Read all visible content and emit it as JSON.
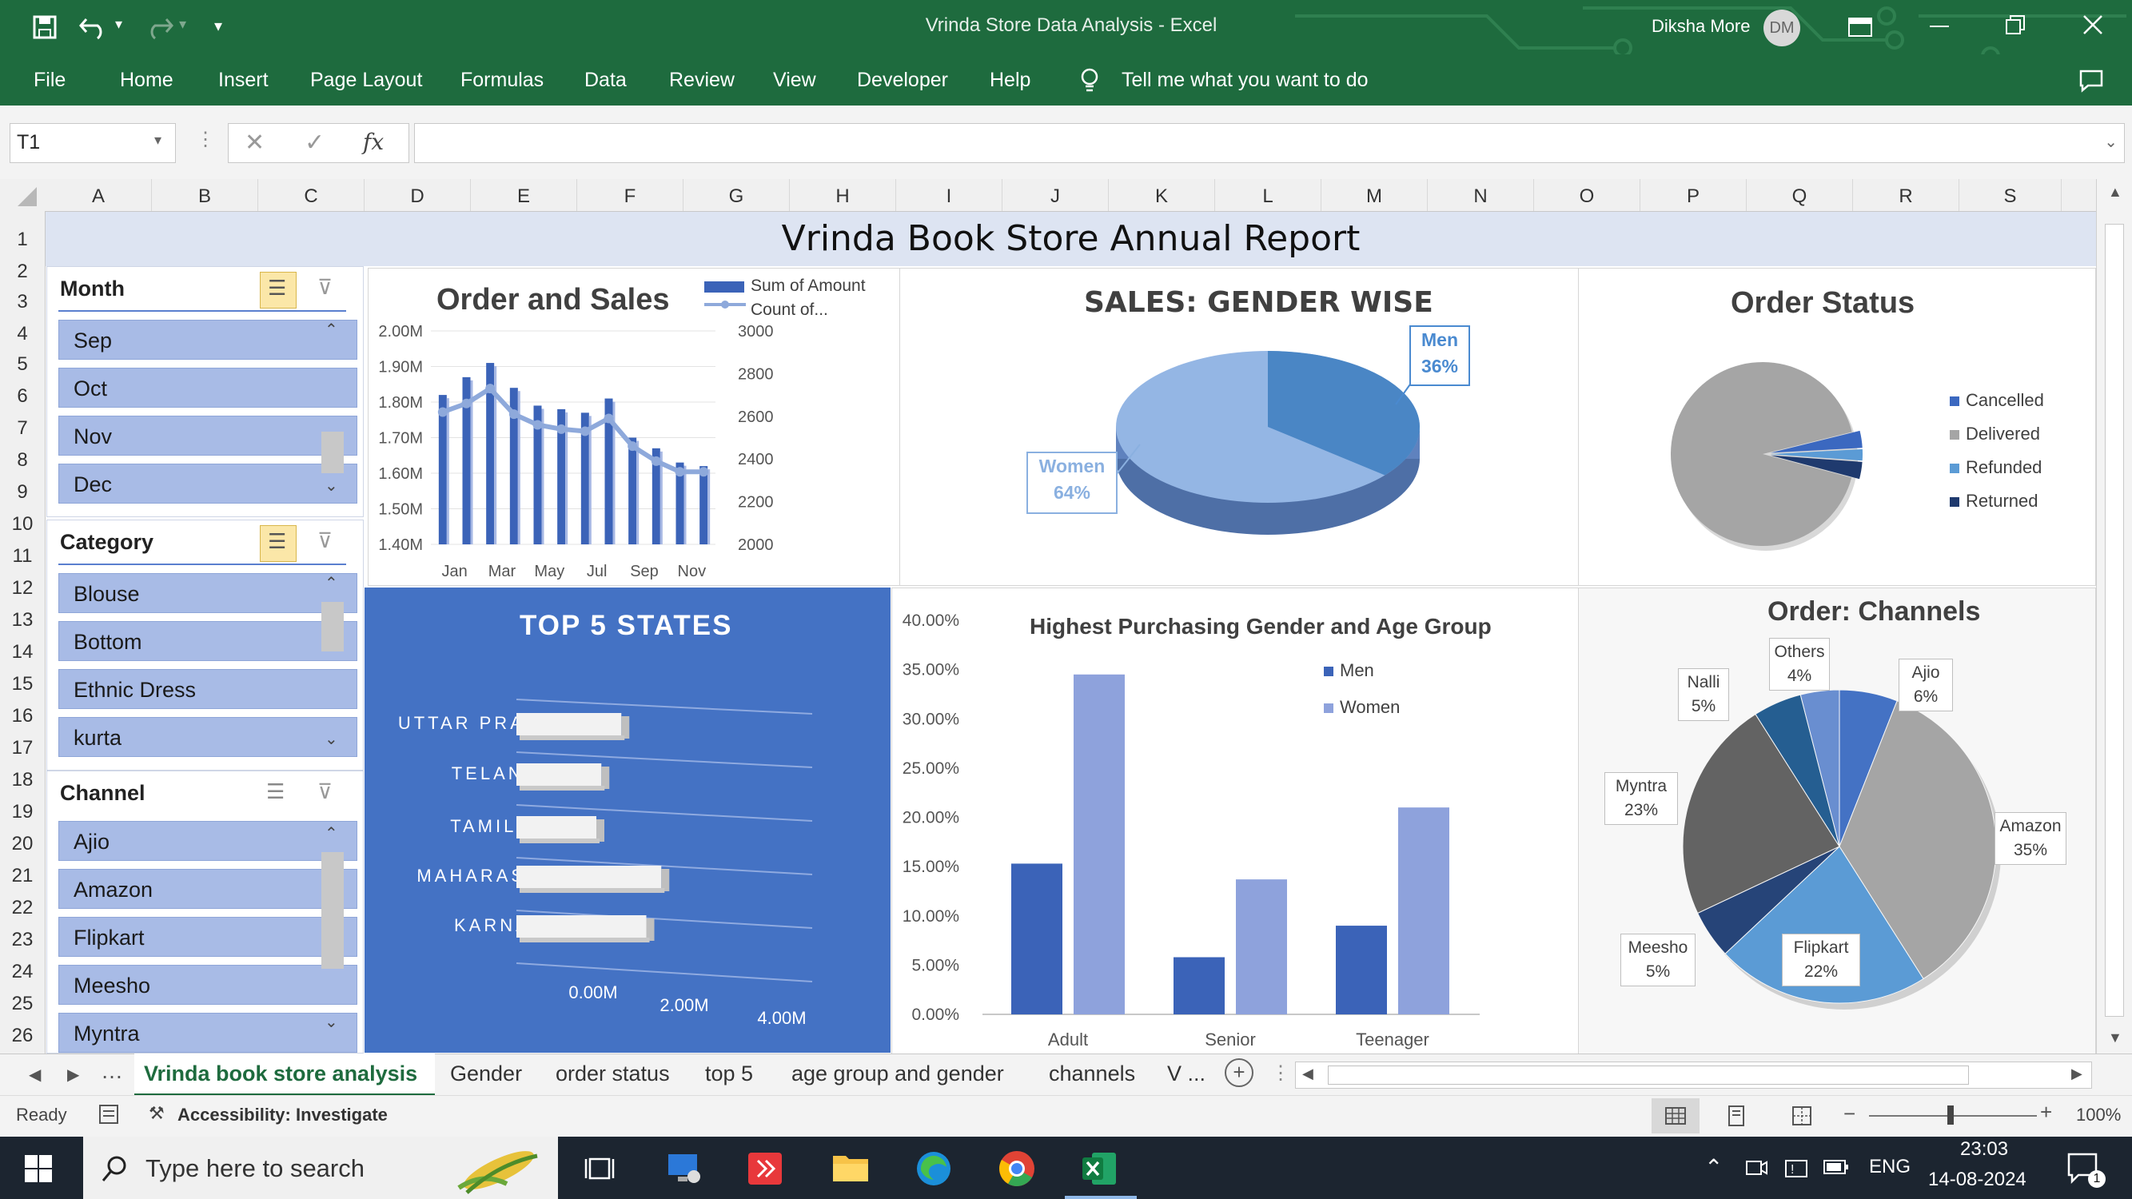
{
  "window": {
    "title": "Vrinda Store Data Analysis  -  Excel",
    "user": "Diksha More",
    "user_initials": "DM"
  },
  "ribbon": {
    "tabs": [
      "File",
      "Home",
      "Insert",
      "Page Layout",
      "Formulas",
      "Data",
      "Review",
      "View",
      "Developer",
      "Help"
    ],
    "tell_me": "Tell me what you want to do"
  },
  "formula_bar": {
    "name_box": "T1",
    "fx": "fx",
    "formula": ""
  },
  "columns": [
    "A",
    "B",
    "C",
    "D",
    "E",
    "F",
    "G",
    "H",
    "I",
    "J",
    "K",
    "L",
    "M",
    "N",
    "O",
    "P",
    "Q",
    "R",
    "S"
  ],
  "rows": [
    "1",
    "2",
    "3",
    "4",
    "5",
    "6",
    "7",
    "8",
    "9",
    "10",
    "11",
    "12",
    "13",
    "14",
    "15",
    "16",
    "17",
    "18",
    "19",
    "20",
    "21",
    "22",
    "23",
    "24",
    "25",
    "26"
  ],
  "report_title": "Vrinda Book Store Annual Report",
  "slicers": {
    "month": {
      "title": "Month",
      "items": [
        "Sep",
        "Oct",
        "Nov",
        "Dec"
      ]
    },
    "category": {
      "title": "Category",
      "items": [
        "Blouse",
        "Bottom",
        "Ethnic Dress",
        "kurta"
      ]
    },
    "channel": {
      "title": "Channel",
      "items": [
        "Ajio",
        "Amazon",
        "Flipkart",
        "Meesho",
        "Myntra"
      ]
    }
  },
  "chart_data": [
    {
      "type": "bar",
      "title": "Order and Sales",
      "categories": [
        "Jan",
        "Feb",
        "Mar",
        "Apr",
        "May",
        "Jun",
        "Jul",
        "Aug",
        "Sep",
        "Oct",
        "Nov",
        "Dec"
      ],
      "x_tick_labels": [
        "Jan",
        "Mar",
        "May",
        "Jul",
        "Sep",
        "Nov"
      ],
      "series": [
        {
          "name": "Sum of Amount",
          "values": [
            1.82,
            1.87,
            1.91,
            1.84,
            1.79,
            1.78,
            1.77,
            1.81,
            1.7,
            1.67,
            1.63,
            1.62
          ]
        },
        {
          "name": "Count of...",
          "values": [
            2620,
            2660,
            2730,
            2610,
            2560,
            2540,
            2530,
            2590,
            2460,
            2390,
            2340,
            2340
          ]
        }
      ],
      "y_left_ticks": [
        "2.00M",
        "1.90M",
        "1.80M",
        "1.70M",
        "1.60M",
        "1.50M",
        "1.40M"
      ],
      "y_right_ticks": [
        "3000",
        "2800",
        "2600",
        "2400",
        "2200",
        "2000"
      ],
      "ylim_left": [
        1.4,
        2.0
      ],
      "ylim_right": [
        2000,
        3000
      ]
    },
    {
      "type": "pie",
      "title": "SALES: GENDER WISE",
      "slices": [
        {
          "label": "Men",
          "pct": "36%",
          "value": 36
        },
        {
          "label": "Women",
          "pct": "64%",
          "value": 64
        }
      ]
    },
    {
      "type": "pie",
      "title": "Order Status",
      "legend": [
        "Cancelled",
        "Delivered",
        "Refunded",
        "Returned"
      ],
      "values": [
        3,
        92,
        2,
        3
      ]
    },
    {
      "type": "bar",
      "title": "TOP 5 STATES",
      "categories": [
        "UTTAR PRADESH",
        "TELANGANA",
        "TAMIL NADU",
        "MAHARASHTRA",
        "KARNATAKA"
      ],
      "values": [
        2.1,
        1.7,
        1.6,
        2.9,
        2.6
      ],
      "x_ticks": [
        "0.00M",
        "2.00M",
        "4.00M"
      ]
    },
    {
      "type": "bar",
      "title": "Highest Purchasing Gender and Age Group",
      "categories": [
        "Adult",
        "Senior",
        "Teenager"
      ],
      "series": [
        {
          "name": "Men",
          "values": [
            15.3,
            5.8,
            9.0
          ]
        },
        {
          "name": "Women",
          "values": [
            34.5,
            13.7,
            21.0
          ]
        }
      ],
      "y_ticks": [
        "40.00%",
        "35.00%",
        "30.00%",
        "25.00%",
        "20.00%",
        "15.00%",
        "10.00%",
        "5.00%",
        "0.00%"
      ],
      "ylim": [
        0,
        40
      ]
    },
    {
      "type": "pie",
      "title": "Order: Channels",
      "slices": [
        {
          "label": "Ajio",
          "pct": "6%",
          "value": 6
        },
        {
          "label": "Amazon",
          "pct": "35%",
          "value": 35
        },
        {
          "label": "Flipkart",
          "pct": "22%",
          "value": 22
        },
        {
          "label": "Meesho",
          "pct": "5%",
          "value": 5
        },
        {
          "label": "Myntra",
          "pct": "23%",
          "value": 23
        },
        {
          "label": "Nalli",
          "pct": "5%",
          "value": 5
        },
        {
          "label": "Others",
          "pct": "4%",
          "value": 4
        }
      ]
    }
  ],
  "sheet_tabs": [
    "Vrinda book store analysis",
    "Gender",
    "order status",
    "top 5",
    "age group and gender",
    "channels",
    "V ..."
  ],
  "status_bar": {
    "ready": "Ready",
    "accessibility": "Accessibility: Investigate",
    "zoom": "100%"
  },
  "taskbar": {
    "search_placeholder": "Type here to search",
    "language": "ENG",
    "time": "23:03",
    "date": "14-08-2024",
    "notifications": "1"
  },
  "colors": {
    "excel_green": "#1e6b3e",
    "slicer_item": "#a8bbe6",
    "states_panel": "#4472c4",
    "title_band": "#dde4f2"
  }
}
